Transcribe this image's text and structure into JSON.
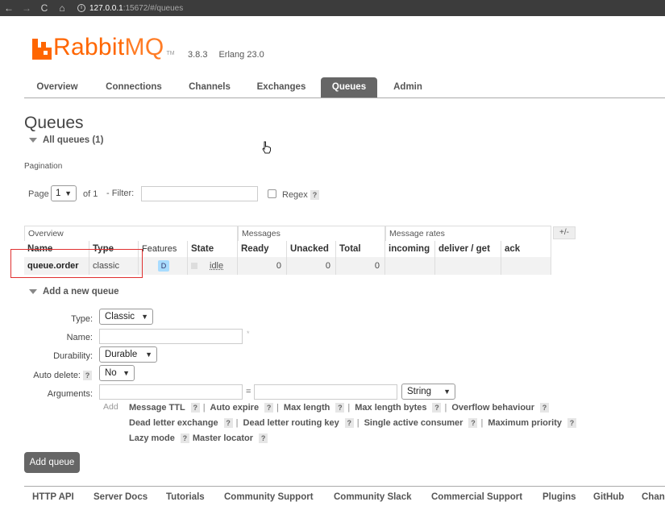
{
  "browser": {
    "back": "←",
    "forward": "→",
    "reload": "C",
    "home": "⌂",
    "info": "i",
    "url_host": "127.0.0.1",
    "url_rest": ":15672/#/queues"
  },
  "header": {
    "logo_rabbit": "Rabbit",
    "logo_mq": "MQ",
    "logo_tm": "TM",
    "version": "3.8.3",
    "erlang": "Erlang 23.0"
  },
  "tabs": [
    "Overview",
    "Connections",
    "Channels",
    "Exchanges",
    "Queues",
    "Admin"
  ],
  "active_tab": "Queues",
  "page": {
    "title": "Queues",
    "all_queues": "All queues (1)",
    "pagination_label": "Pagination",
    "page_label": "Page",
    "page_value": "1",
    "of_label": "of 1",
    "filter_label": "- Filter:",
    "filter_value": "",
    "regex_label": "Regex",
    "help": "?"
  },
  "table": {
    "groups": [
      "Overview",
      "Messages",
      "Message rates"
    ],
    "plusminus": "+/-",
    "headers": [
      "Name",
      "Type",
      "Features",
      "State",
      "Ready",
      "Unacked",
      "Total",
      "incoming",
      "deliver / get",
      "ack"
    ],
    "rows": [
      {
        "name": "queue.order",
        "type": "classic",
        "feature": "D",
        "state": "idle",
        "ready": "0",
        "unacked": "0",
        "total": "0",
        "incoming": "",
        "deliver_get": "",
        "ack": ""
      }
    ]
  },
  "add_queue": {
    "section_title": "Add a new queue",
    "type_label": "Type:",
    "type_value": "Classic",
    "name_label": "Name:",
    "name_required": "*",
    "durability_label": "Durability:",
    "durability_value": "Durable",
    "auto_delete_label": "Auto delete:",
    "auto_delete_value": "No",
    "arguments_label": "Arguments:",
    "equals": "=",
    "arg_type_value": "String",
    "add_label": "Add",
    "arg_links": [
      "Message TTL",
      "Auto expire",
      "Max length",
      "Max length bytes",
      "Overflow behaviour",
      "Dead letter exchange",
      "Dead letter routing key",
      "Single active consumer",
      "Maximum priority",
      "Lazy mode",
      "Master locator"
    ],
    "submit_label": "Add queue"
  },
  "footer": [
    "HTTP API",
    "Server Docs",
    "Tutorials",
    "Community Support",
    "Community Slack",
    "Commercial Support",
    "Plugins",
    "GitHub",
    "Chan"
  ],
  "colors": {
    "brand": "#ff6600",
    "active_tab": "#666666",
    "feature_badge": "#a8dcff",
    "annotation_box": "#e03030"
  }
}
